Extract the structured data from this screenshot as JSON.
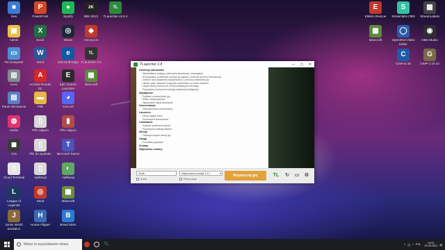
{
  "desktop": {
    "icons": [
      {
        "label": "Sesi",
        "color": "#3a7bd5",
        "glyph": "■"
      },
      {
        "label": "PowerPoint",
        "color": "#d24726",
        "glyph": "P"
      },
      {
        "label": "Spotify",
        "color": "#1db954",
        "glyph": "●"
      },
      {
        "label": "NBA 2K21",
        "color": "#222222",
        "glyph": "2K"
      },
      {
        "label": "TLauncher v2.0.4",
        "color": "#2b8a3e",
        "glyph": "TL"
      },
      {
        "label": "Admin",
        "color": "#e8c04a",
        "glyph": "▣"
      },
      {
        "label": "Excel",
        "color": "#1d6f42",
        "glyph": "X"
      },
      {
        "label": "Steam",
        "color": "#1b2838",
        "glyph": "◎"
      },
      {
        "label": "Among Us",
        "color": "#c0392b",
        "glyph": "◆"
      },
      {
        "label": "Ten komputer",
        "color": "#4a90d9",
        "glyph": "▭"
      },
      {
        "label": "Word",
        "color": "#2b579a",
        "glyph": "W"
      },
      {
        "label": "Microsoft Edge",
        "color": "#0c59a4",
        "glyph": "e"
      },
      {
        "label": "TLauncher 2.0",
        "color": "#333333",
        "glyph": "TL"
      },
      {
        "label": "Kosz",
        "color": "#7f8c8d",
        "glyph": "▥"
      },
      {
        "label": "Acrobat Reader DC",
        "color": "#d4272a",
        "glyph": "A"
      },
      {
        "label": "Epic Games Launcher",
        "color": "#2a2a2a",
        "glyph": "E"
      },
      {
        "label": "Minecraft",
        "color": "#5c8a3c",
        "glyph": "▦"
      },
      {
        "label": "Panel sterowania",
        "color": "#5b7fc7",
        "glyph": "▤"
      },
      {
        "label": "Pliki",
        "color": "#e6b84a",
        "glyph": "▬"
      },
      {
        "label": "Discord",
        "color": "#5865f2",
        "glyph": "◕"
      },
      {
        "label": "Adobe",
        "color": "#e0336e",
        "glyph": "◍"
      },
      {
        "label": "Pliki zdjęcia",
        "color": "#d8d8d8",
        "glyph": "▯"
      },
      {
        "label": "Pliki zdjęcia",
        "color": "#b34a4a",
        "glyph": "▮"
      },
      {
        "label": "Gra",
        "color": "#3a3a3a",
        "glyph": "◼"
      },
      {
        "label": "Plik do wydruku",
        "color": "#d8d8d8",
        "glyph": "▯"
      },
      {
        "label": "Microsoft Teams",
        "color": "#4b53bc",
        "glyph": "T"
      },
      {
        "label": "Cloud Terminal",
        "color": "#e6e6e6",
        "glyph": "▯"
      },
      {
        "label": "Aplikacja",
        "color": "#d8d8d8",
        "glyph": "▯"
      },
      {
        "label": "Aplikacja",
        "color": "#5fa85f",
        "glyph": "◐"
      },
      {
        "label": "League of Legends",
        "color": "#1e3a5f",
        "glyph": "L"
      },
      {
        "label": "Skrót",
        "color": "#c0392b",
        "glyph": "◎"
      },
      {
        "label": "Minecraft",
        "color": "#6b8e3a",
        "glyph": "▦"
      },
      {
        "label": "Junior World Evolution",
        "color": "#8a6a3a",
        "glyph": "J"
      },
      {
        "label": "House Flipper",
        "color": "#3a6ab0",
        "glyph": "H"
      },
      {
        "label": "Brawl Stars",
        "color": "#2a7ad0",
        "glyph": "B"
      },
      {
        "label": "Elektro Rescue",
        "color": "#c0392b",
        "glyph": "E"
      },
      {
        "label": "Streamlabs OBS",
        "color": "#31c3a2",
        "glyph": "S"
      },
      {
        "label": "StreamLabels",
        "color": "#444444",
        "glyph": "▩"
      },
      {
        "label": "Minecraft",
        "color": "#5c8a3c",
        "glyph": "▦"
      },
      {
        "label": "OpenShot Video Editor",
        "color": "#2a5caa",
        "glyph": "◯"
      },
      {
        "label": "OBS Studio",
        "color": "#302e31",
        "glyph": "◉"
      },
      {
        "label": "Cinema 4D",
        "color": "#1e5aa8",
        "glyph": "C"
      },
      {
        "label": "GIMP 2.10.24",
        "color": "#7a6a4a",
        "glyph": "G"
      }
    ]
  },
  "window": {
    "title": "TLauncher 2.8",
    "notes": [
      {
        "type": "h",
        "text": "Kolekcja odnośnika"
      },
      {
        "type": "i",
        "text": "- Wyświetlanie postępu pobierania aktualizacji i przesyłania"
      },
      {
        "type": "i",
        "text": "- W przypadku problemów możesz go zgłosić na stronie pomocy technicznej"
      },
      {
        "type": "i",
        "text": "- Dodano tryb ustawienia odzyskiwania, 1 pomocy ustawiania gry"
      },
      {
        "type": "i",
        "text": "- Ukryte opcje ustawień mogą być wyświetlone w oknie ustawień"
      },
      {
        "type": "i",
        "text": "- Użycie ikony w tlenie lub w linii przesłanych informacji"
      },
      {
        "type": "i",
        "text": "- Poprawiony komponent obsługi zapisanej konfiguracji"
      },
      {
        "type": "h",
        "text": "Wydajność"
      },
      {
        "type": "i",
        "text": "- Szybsze uruchamianie gry"
      },
      {
        "type": "i",
        "text": "- Mniej zużytej pamięci"
      },
      {
        "type": "i",
        "text": "- Naprawiono błędy ładowania"
      },
      {
        "type": "h",
        "text": "Konserwacja"
      },
      {
        "type": "i",
        "text": "- Zaktualizowano komponenty"
      },
      {
        "type": "h",
        "text": "Launcher"
      },
      {
        "type": "i",
        "text": "- Nowy wygląd okna"
      },
      {
        "type": "i",
        "text": "- Poprawione tłumaczenia"
      },
      {
        "type": "h",
        "text": "Ładowanie"
      },
      {
        "type": "i",
        "text": "- Szybsze pobieranie plików"
      },
      {
        "type": "i",
        "text": "- Poprawiona obsługa błędów"
      },
      {
        "type": "h",
        "text": "Wersje"
      },
      {
        "type": "i",
        "text": "- Obsługa nowych wersji gry"
      },
      {
        "type": "h",
        "text": "Uwagi"
      },
      {
        "type": "i",
        "text": "- Pozostałe poprawki"
      },
      {
        "type": "h",
        "text": "Zmiany"
      },
      {
        "type": "h",
        "text": "Najnowsze zmiany"
      }
    ],
    "username": "Wnik",
    "version_select": "Najnowsza wersja 1.17",
    "checkbox_accounts": "Konta",
    "checkbox_fullscreen": "Pełny ekran",
    "play_label": "Rozpocznij grę",
    "logo_glyph": "TL",
    "refresh_glyph": "↻",
    "folder_glyph": "▭",
    "settings_glyph": "⚙"
  },
  "taskbar": {
    "search_placeholder": "Wpisz tu wyszukiwane słowa",
    "time": "14:51",
    "date": "25.06.2021",
    "lang": "POL",
    "notifications_glyph": "▤"
  }
}
